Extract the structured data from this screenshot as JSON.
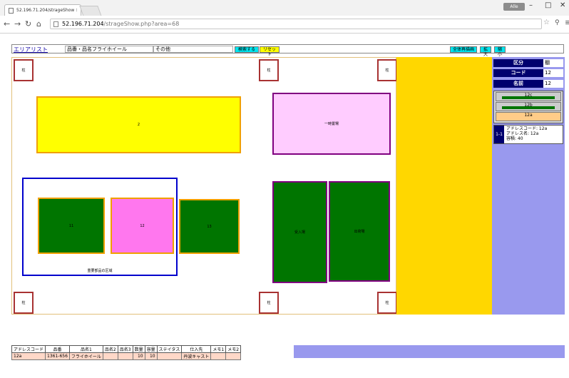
{
  "browser": {
    "tab_title": "52.196.71.204/strageShow ×",
    "url_host": "52.196.71.204",
    "url_path": "/strageShow.php?area=68",
    "win_label": "Alle"
  },
  "toolbar": {
    "area_list_link": "エリアリスト",
    "field1": "品番・品名フライホイール",
    "field2": "その他",
    "search_button": "検索する",
    "reset_button": "リセット",
    "full_redraw_button": "全体再描画",
    "zoom_in_button": "拡大",
    "zoom_out_button": "縮小"
  },
  "map": {
    "pillar_label": "柱",
    "box_2": "2",
    "box_temp": "一時置場",
    "box_11": "11",
    "box_12": "12",
    "box_13": "13",
    "box_receiving": "受入場",
    "box_shipping": "出荷場",
    "area_label": "重要部品の区域"
  },
  "side": {
    "kubun_label": "区分",
    "kubun_value": "棚",
    "code_label": "コード",
    "code_value": "12",
    "name_label": "名前",
    "name_value": "12",
    "tier_c": "12c",
    "tier_b": "12b",
    "tier_a": "12a",
    "addr_label": "1-1",
    "addr_line1": "アドレスコード: 12a",
    "addr_line2": "アドレス名: 12a",
    "addr_line3": "容積: 40"
  },
  "table": {
    "headers": [
      "アドレスコード",
      "品番",
      "品名1",
      "品名2",
      "品名3",
      "数量",
      "容量",
      "ステイタス",
      "仕入先",
      "メモ1",
      "メモ2"
    ],
    "rows": [
      [
        "12a",
        "1361-656",
        "フライホイール",
        "",
        "",
        "10",
        "10",
        "",
        "丹波キャスト",
        "",
        ""
      ]
    ]
  },
  "colors": {
    "yellow_box": "#ffff00",
    "pink_box": "#ffccff",
    "magenta_box": "#ff77ee",
    "green_box": "#007500",
    "gold_bar": "#ffd700",
    "side_panel": "#9999ee",
    "navy": "#00006e"
  }
}
